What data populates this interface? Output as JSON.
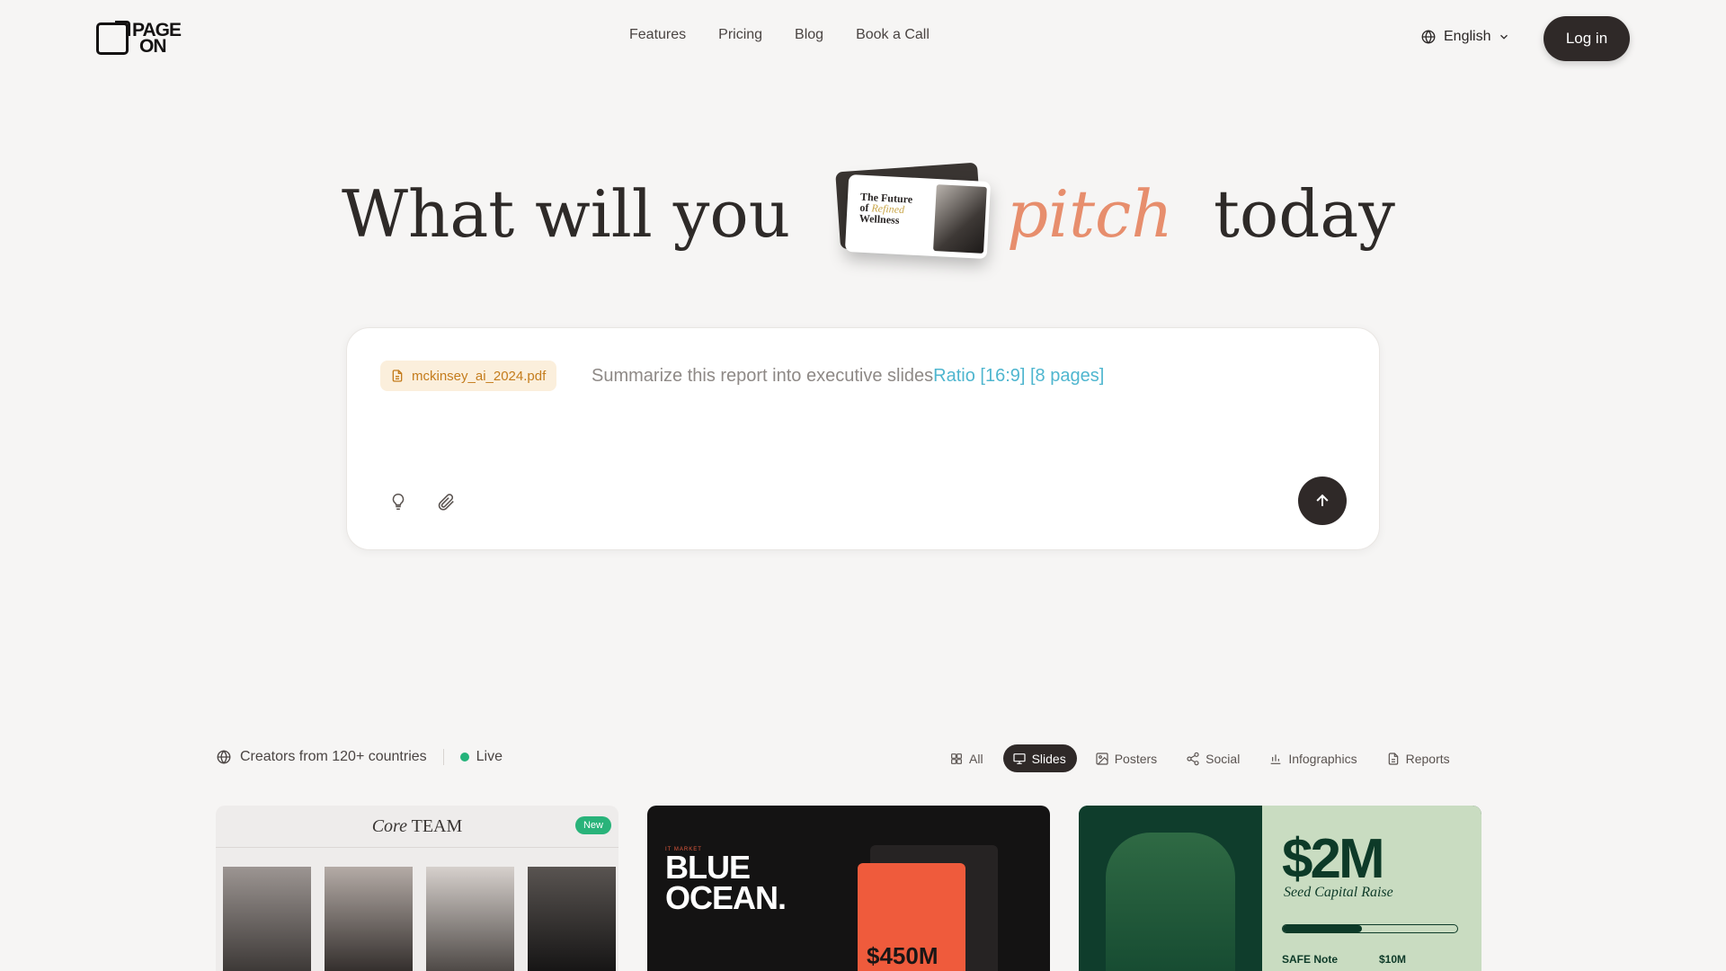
{
  "brand": {
    "logo_line1": "PAGE",
    "logo_line2": "ON"
  },
  "nav": {
    "items": [
      {
        "label": "Features"
      },
      {
        "label": "Pricing"
      },
      {
        "label": "Blog"
      },
      {
        "label": "Book a Call"
      }
    ]
  },
  "language": {
    "label": "English"
  },
  "auth": {
    "login_label": "Log in"
  },
  "hero": {
    "part1": "What will you",
    "accent": "pitch",
    "part3": "today",
    "thumbnail": {
      "title_1": "The Future",
      "title_2": "of",
      "title_accent": "Refined",
      "title_3": "Wellness"
    },
    "accent_color": "#e78e6d"
  },
  "prompt": {
    "attachment": "mckinsey_ai_2024.pdf",
    "text": "Summarize this report into executive slides",
    "params": "Ratio [16:9] [8 pages]",
    "idea_icon": "lightbulb-icon",
    "attach_icon": "paperclip-icon",
    "send_icon": "arrow-up-icon"
  },
  "meta": {
    "creators": "Creators from 120+ countries",
    "live": "Live",
    "live_color": "#24b37a"
  },
  "filters": [
    {
      "label": "All",
      "icon": "grid-icon",
      "active": false
    },
    {
      "label": "Slides",
      "icon": "presentation-icon",
      "active": true
    },
    {
      "label": "Posters",
      "icon": "image-icon",
      "active": false
    },
    {
      "label": "Social",
      "icon": "share-icon",
      "active": false
    },
    {
      "label": "Infographics",
      "icon": "bar-chart-icon",
      "active": false
    },
    {
      "label": "Reports",
      "icon": "document-icon",
      "active": false
    }
  ],
  "cards": [
    {
      "title_a": "Core",
      "title_b": "TEAM",
      "badge": "New"
    },
    {
      "kicker": "IT MARKET",
      "title_1": "BLUE",
      "title_2": "OCEAN.",
      "amount": "$450M"
    },
    {
      "big": "$2M",
      "sub": "Seed Capital Raise",
      "footer_left": "SAFE Note",
      "footer_right": "$10M"
    }
  ]
}
